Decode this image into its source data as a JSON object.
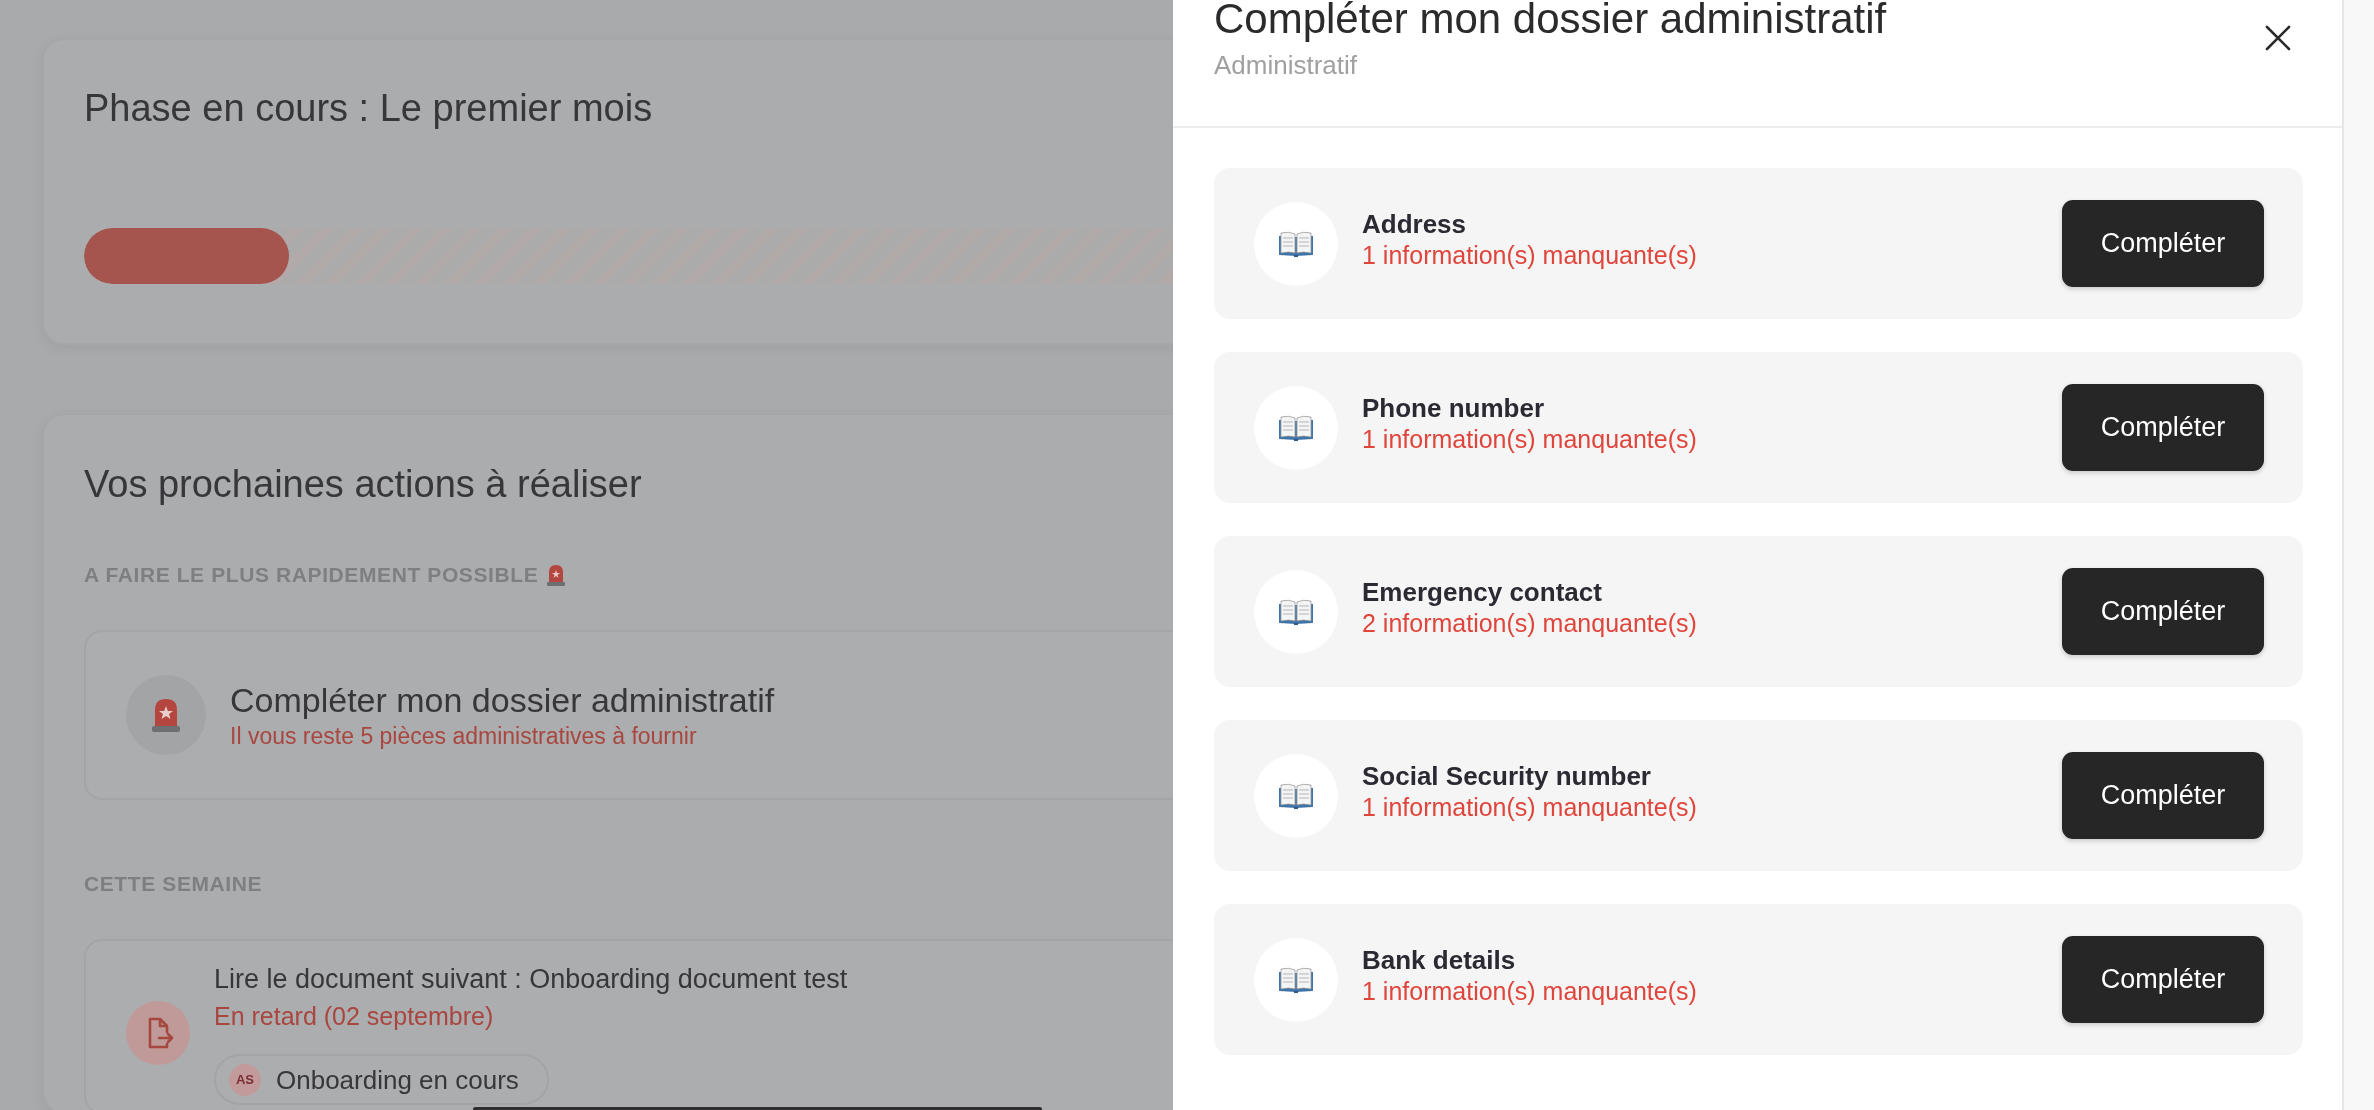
{
  "phase_card": {
    "title": "Phase en cours : Le premier mois",
    "progress": {
      "level": 0.093
    }
  },
  "actions_card": {
    "title": "Vos prochaines actions à réaliser",
    "sections": [
      {
        "kind": "urgent",
        "label": "A FAIRE LE PLUS RAPIDEMENT POSSIBLE",
        "items": [
          {
            "kind": "urgent",
            "title": "Compléter mon dossier administratif",
            "subtitle": "Il vous reste 5 pièces administratives à fournir"
          }
        ]
      },
      {
        "kind": "week",
        "label": "CETTE SEMAINE",
        "items": [
          {
            "kind": "document",
            "title": "Lire le document suivant : Onboarding document test",
            "subtitle": "En retard (02 septembre)",
            "tag": {
              "initials": "AS",
              "label": "Onboarding en cours"
            }
          }
        ]
      }
    ]
  },
  "drawer": {
    "title": "Compléter mon dossier administratif",
    "subtitle": "Administratif",
    "items": [
      {
        "title": "Address",
        "status": "1 information(s) manquante(s)",
        "button": "Compléter"
      },
      {
        "title": "Phone number",
        "status": "1 information(s) manquante(s)",
        "button": "Compléter"
      },
      {
        "title": "Emergency contact",
        "status": "2 information(s) manquante(s)",
        "button": "Compléter"
      },
      {
        "title": "Social Security number",
        "status": "1 information(s) manquante(s)",
        "button": "Compléter"
      },
      {
        "title": "Bank details",
        "status": "1 information(s) manquante(s)",
        "button": "Compléter"
      }
    ]
  }
}
